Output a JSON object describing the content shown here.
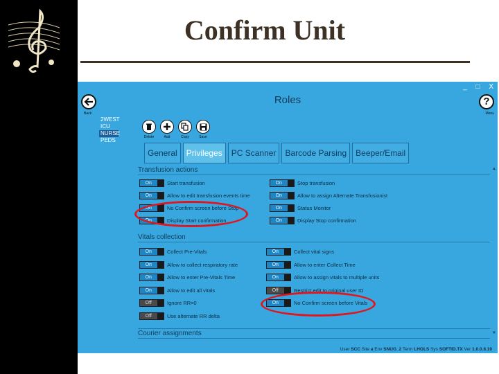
{
  "slide": {
    "title": "Confirm Unit"
  },
  "window": {
    "title": "Roles",
    "controls": [
      "_",
      "□",
      "X"
    ],
    "back_label": "Back",
    "help_symbol": "?",
    "help_label": "Menu"
  },
  "units": [
    "2WEST",
    "ICU",
    "NURSE",
    "PEDS"
  ],
  "toolbar": [
    {
      "label": "Delete",
      "icon": "trash-icon"
    },
    {
      "label": "Add",
      "icon": "plus-icon"
    },
    {
      "label": "Copy",
      "icon": "copy-icon"
    },
    {
      "label": "Save",
      "icon": "save-icon"
    }
  ],
  "tabs": [
    "General",
    "Privileges",
    "PC Scanner",
    "Barcode Parsing",
    "Beeper/Email"
  ],
  "sections": {
    "transfusion": "Transfusion actions",
    "vitals": "Vitals collection",
    "courier": "Courier assignments"
  },
  "transfusion_left": [
    {
      "state": "On",
      "label": "Start transfusion"
    },
    {
      "state": "On",
      "label": "Allow to edit transfusion events time"
    },
    {
      "state": "On",
      "label": "No Confirm screen before Stop"
    },
    {
      "state": "On",
      "label": "Display Start confirmation"
    }
  ],
  "transfusion_right": [
    {
      "state": "On",
      "label": "Stop transfusion"
    },
    {
      "state": "On",
      "label": "Allow to assign Alternate Transfusionist"
    },
    {
      "state": "On",
      "label": "Status Monitor"
    },
    {
      "state": "On",
      "label": "Display Stop confirmation"
    }
  ],
  "vitals_left": [
    {
      "state": "On",
      "label": "Collect Pre-Vitals"
    },
    {
      "state": "On",
      "label": "Allow to collect respiratory rate"
    },
    {
      "state": "On",
      "label": "Allow to enter Pre-Vitals Time"
    },
    {
      "state": "On",
      "label": "Allow to edit all vitals"
    },
    {
      "state": "Off",
      "label": "Ignore RR=0"
    },
    {
      "state": "Off",
      "label": "Use alternate RR delta"
    }
  ],
  "vitals_right": [
    {
      "state": "On",
      "label": "Collect vital signs"
    },
    {
      "state": "On",
      "label": "Allow to enter Collect Time"
    },
    {
      "state": "On",
      "label": "Allow to assign vitals to multiple units"
    },
    {
      "state": "Off",
      "label": "Restrict edit to original user ID"
    },
    {
      "state": "On",
      "label": "No Confirm screen before Vitals"
    }
  ],
  "status": {
    "user_label": "User",
    "user": "SCC",
    "site_label": "Site",
    "site": "a",
    "env_label": "Env",
    "env": "SNUG_2",
    "term_label": "Term",
    "term": "LHOLS",
    "sys_label": "Sys",
    "sys": "SOFTID.TX",
    "ver_label": "Ver",
    "ver": "1.0.0.8.10"
  },
  "colors": {
    "window_bg": "#38a7df",
    "toggle_on": "#1f86c6",
    "toggle_off": "#4a4a4a",
    "annotation": "#e0161f",
    "title_text": "#3c3124"
  }
}
